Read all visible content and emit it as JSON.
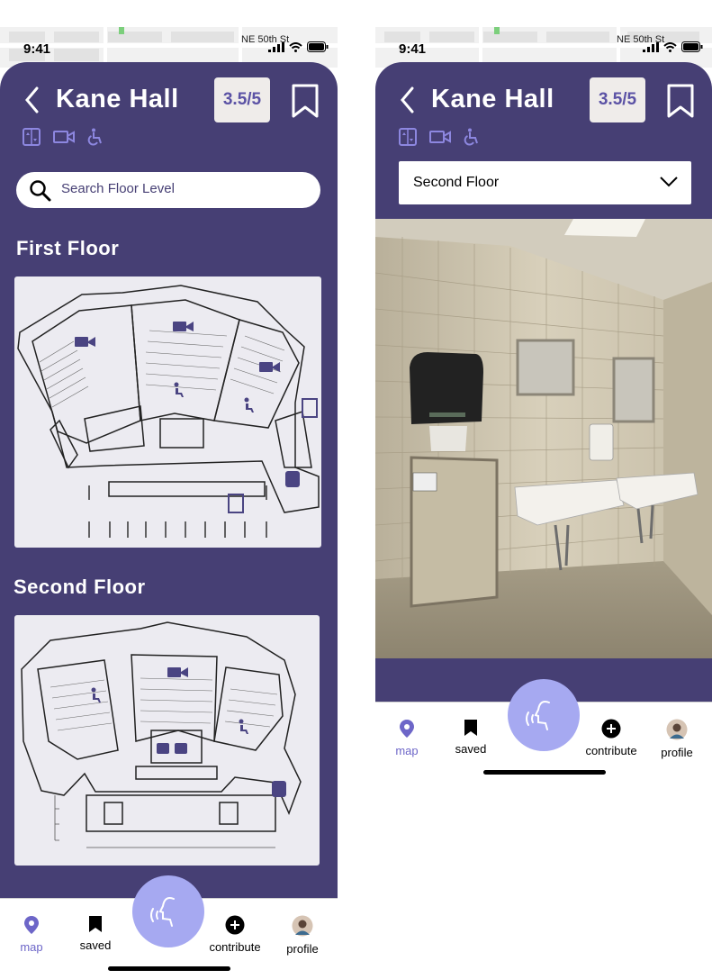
{
  "status": {
    "time": "9:41",
    "street": "NE 50th St"
  },
  "building": {
    "name": "Kane Hall",
    "rating": "3.5/5"
  },
  "amenities": [
    "elevator-icon",
    "camera-icon",
    "wheelchair-icon"
  ],
  "search": {
    "placeholder": "Search Floor Level"
  },
  "floors": [
    {
      "title": "First Floor"
    },
    {
      "title": "Second Floor"
    }
  ],
  "dropdown": {
    "selected": "Second Floor"
  },
  "nav": {
    "map": "map",
    "saved": "saved",
    "contribute": "contribute",
    "profile": "profile"
  },
  "colors": {
    "brand": "#463f74",
    "accent": "#6d66c8",
    "fab": "#a6a9f1",
    "rating_bg": "#efecea"
  }
}
